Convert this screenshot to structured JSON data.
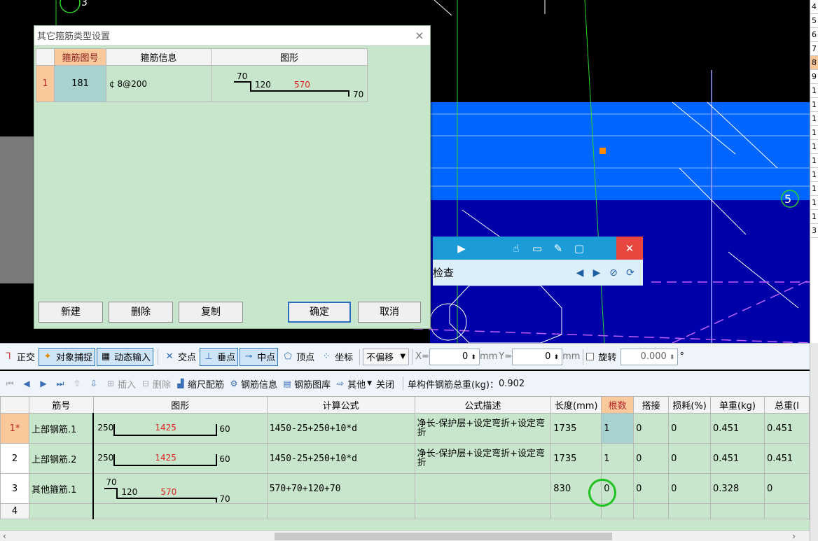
{
  "dialog": {
    "title": "其它箍筋类型设置",
    "close_glyph": "×",
    "columns": [
      "箍筋图号",
      "箍筋信息",
      "图形"
    ],
    "row": {
      "num": "1",
      "code": "181",
      "info": "¢ 8@200",
      "fig": {
        "top": "70",
        "left": "120",
        "mid": "570",
        "right": "70"
      }
    },
    "buttons": {
      "new": "新建",
      "delete": "删除",
      "copy": "复制",
      "ok": "确定",
      "cancel": "取消"
    }
  },
  "floatbar": {
    "label": "检查"
  },
  "cad": {
    "marker_top": "3",
    "marker_right": "5"
  },
  "rightlist": [
    "4",
    "5",
    "6",
    "7",
    "8",
    "9",
    "1",
    "1",
    "1",
    "1",
    "1",
    "1",
    "1",
    "1",
    "1",
    "1",
    "3"
  ],
  "snapbar": {
    "ortho": "正交",
    "snap": "对象捕捉",
    "dynamic": "动态输入",
    "intersect": "交点",
    "perp": "垂点",
    "mid": "中点",
    "vertex": "顶点",
    "coord": "坐标",
    "offset": "不偏移",
    "x_label": "X=",
    "x_value": "0",
    "mm1": "mm",
    "y_label": "Y=",
    "y_value": "0",
    "mm2": "mm",
    "rotate": "旋转",
    "rotate_value": "0.000",
    "degree": "°"
  },
  "steelbar": {
    "insert": "插入",
    "delete": "删除",
    "scale": "缩尺配筋",
    "info": "钢筋信息",
    "library": "钢筋图库",
    "other": "其他",
    "close": "关闭",
    "total_label": "单构件钢筋总重(kg)：",
    "total_value": "0.902"
  },
  "grid": {
    "headers": [
      "",
      "筋号",
      "图形",
      "计算公式",
      "公式描述",
      "长度(mm)",
      "根数",
      "搭接",
      "损耗(%)",
      "单重(kg)",
      "总重(l"
    ],
    "rows": [
      {
        "num": "1*",
        "name": "上部钢筋.1",
        "fig": {
          "left": "250",
          "mid": "1425",
          "right": "60"
        },
        "formula": "1450-25+250+10*d",
        "desc": "净长-保护层+设定弯折+设定弯折",
        "length": "1735",
        "count": "1",
        "lap": "0",
        "loss": "0",
        "unit": "0.451",
        "total": "0.451"
      },
      {
        "num": "2",
        "name": "上部钢筋.2",
        "fig": {
          "left": "250",
          "mid": "1425",
          "right": "60"
        },
        "formula": "1450-25+250+10*d",
        "desc": "净长-保护层+设定弯折+设定弯折",
        "length": "1735",
        "count": "1",
        "lap": "0",
        "loss": "0",
        "unit": "0.451",
        "total": "0.451"
      },
      {
        "num": "3",
        "name": "其他箍筋.1",
        "fig": {
          "top": "70",
          "left": "120",
          "mid": "570",
          "right": "70"
        },
        "formula": "570+70+120+70",
        "desc": "",
        "length": "830",
        "count": "0",
        "lap": "0",
        "loss": "0",
        "unit": "0.328",
        "total": "0"
      },
      {
        "num": "4"
      }
    ]
  },
  "colors": {
    "accent_blue": "#1c9bd9",
    "grid_green": "#c7e6cb",
    "header_orange": "#f9c89b",
    "red_dim": "#e02020"
  }
}
